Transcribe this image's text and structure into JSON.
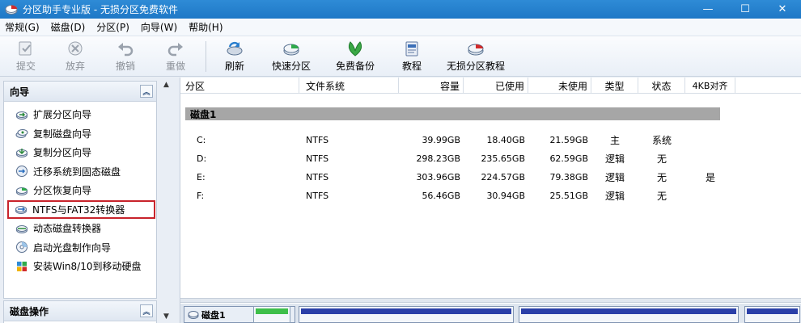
{
  "window": {
    "title": "分区助手专业版 - 无损分区免费软件",
    "min_symbol": "—",
    "max_symbol": "☐",
    "close_symbol": "✕"
  },
  "menu": [
    "常规(G)",
    "磁盘(D)",
    "分区(P)",
    "向导(W)",
    "帮助(H)"
  ],
  "toolbar": {
    "commit": "提交",
    "discard": "放弃",
    "undo": "撤销",
    "redo": "重做",
    "refresh": "刷新",
    "quick_partition": "快速分区",
    "free_backup": "免费备份",
    "tutorial": "教程",
    "lossless_tutorial": "无损分区教程"
  },
  "wizard_panel": {
    "title": "向导",
    "items": [
      "扩展分区向导",
      "复制磁盘向导",
      "复制分区向导",
      "迁移系统到固态磁盘",
      "分区恢复向导",
      "NTFS与FAT32转换器",
      "动态磁盘转换器",
      "启动光盘制作向导",
      "安装Win8/10到移动硬盘"
    ]
  },
  "disk_ops_panel": {
    "title": "磁盘操作"
  },
  "table": {
    "headers": [
      "分区",
      "文件系统",
      "容量",
      "已使用",
      "未使用",
      "类型",
      "状态",
      "4KB对齐"
    ],
    "disk_label": "磁盘1",
    "rows": [
      [
        "C:",
        "NTFS",
        "39.99GB",
        "18.40GB",
        "21.59GB",
        "主",
        "系统",
        ""
      ],
      [
        "D:",
        "NTFS",
        "298.23GB",
        "235.65GB",
        "62.59GB",
        "逻辑",
        "无",
        ""
      ],
      [
        "E:",
        "NTFS",
        "303.96GB",
        "224.57GB",
        "79.38GB",
        "逻辑",
        "无",
        "是"
      ],
      [
        "F:",
        "NTFS",
        "56.46GB",
        "30.94GB",
        "25.51GB",
        "逻辑",
        "无",
        ""
      ]
    ]
  },
  "disk_map": {
    "disk_label": "磁盘1"
  },
  "colors": {
    "titlebar": "#1f78c6",
    "highlight_border": "#c8232b",
    "disk_row_bg": "#a6a6a6",
    "partition_bar": "#2b3fa8"
  }
}
